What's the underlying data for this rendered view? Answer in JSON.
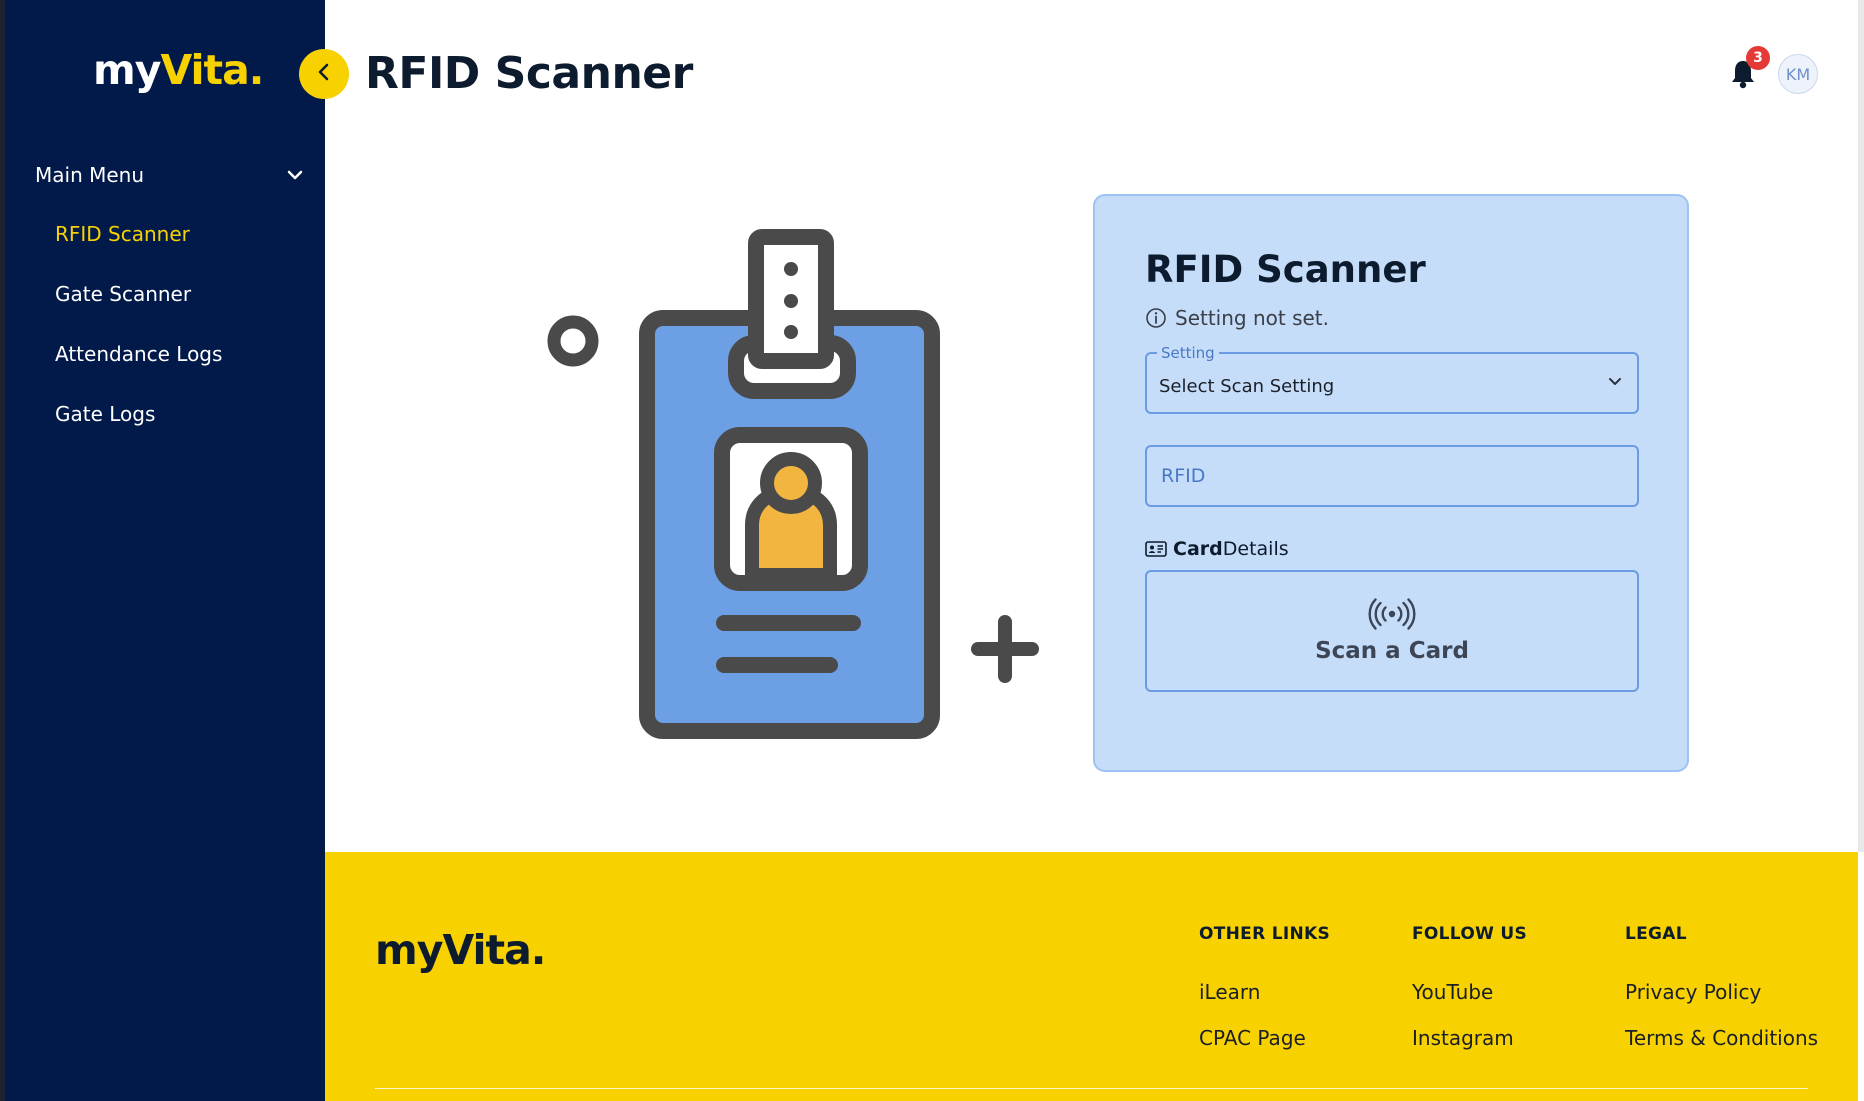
{
  "brand": {
    "name_part1": "my",
    "name_part2": "Vita."
  },
  "sidebar": {
    "menu_header": "Main Menu",
    "items": [
      {
        "label": "RFID Scanner",
        "active": true
      },
      {
        "label": "Gate Scanner",
        "active": false
      },
      {
        "label": "Attendance Logs",
        "active": false
      },
      {
        "label": "Gate Logs",
        "active": false
      }
    ]
  },
  "header": {
    "title": "RFID Scanner",
    "notification_count": "3",
    "avatar_initials": "KM"
  },
  "panel": {
    "title_bold": "RFID",
    "title_rest": " Scanner",
    "status": "Setting not set.",
    "setting": {
      "legend": "Setting",
      "value": "Select Scan Setting"
    },
    "rfid": {
      "placeholder": "RFID",
      "value": ""
    },
    "card_details": {
      "bold": "Card",
      "rest": "Details"
    },
    "scan_label": "Scan a Card"
  },
  "footer": {
    "columns": [
      {
        "heading": "OTHER LINKS",
        "links": [
          "iLearn",
          "CPAC Page"
        ]
      },
      {
        "heading": "FOLLOW US",
        "links": [
          "YouTube",
          "Instagram"
        ]
      },
      {
        "heading": "LEGAL",
        "links": [
          "Privacy Policy",
          "Terms & Conditions"
        ]
      }
    ]
  },
  "colors": {
    "sidebar_bg": "#021a4a",
    "accent_yellow": "#f7d100",
    "panel_bg": "#c5ddf9",
    "panel_border": "#6b9be3",
    "badge_red": "#e53935"
  },
  "icons": [
    "chevron-down-icon",
    "chevron-left-icon",
    "bell-icon",
    "info-icon",
    "id-card-icon",
    "rfid-wave-icon"
  ]
}
